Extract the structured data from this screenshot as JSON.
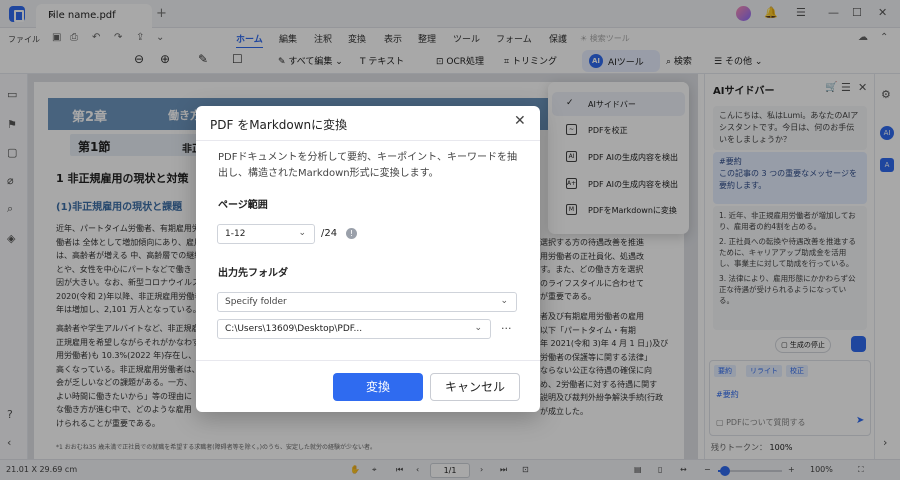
{
  "titlebar": {
    "tab_name": "File name.pdf",
    "close": "×",
    "plus": "+"
  },
  "menubar": {
    "file": "ファイル",
    "items": [
      "ホーム",
      "編集",
      "注釈",
      "変換",
      "表示",
      "整理",
      "ツール",
      "フォーム",
      "保護"
    ],
    "ocr_search": "検索ツール"
  },
  "toolbar": {
    "edit_all": "すべて編集",
    "text": "テキスト",
    "ocr": "OCR処理",
    "trim": "トリミング",
    "ai_tool": "AIツール",
    "search": "検索",
    "more": "その他"
  },
  "ai_menu": {
    "items": [
      "AIサイドバー",
      "PDFを校正",
      "PDF AIの生成内容を検出",
      "PDF AIの生成内容を検出",
      "PDFをMarkdownに変換"
    ]
  },
  "document": {
    "chapter": "第2章",
    "chapter_title": "働き方",
    "section": "第1節",
    "section_title": "非正規",
    "h1": "1 非正規雇用の現状と対策",
    "h2": "(1)非正規雇用の現状と課題",
    "para_left": [
      "近年、パートタイム労働者、有期雇用労",
      "働者は 全体として増加傾向にあり、雇用",
      "は、高齢者が増える 中、高齢層での継続",
      "とや、女性を中心にパートなどで働き",
      "因が大きい。なお、新型コロナウイルス",
      "2020(令和 2)年以降、非正規雇用労働者",
      "年は増加し、2,101 万人となっている。"
    ],
    "para_left2": [
      "高齢者や学生アルバイトなど、非正規雇",
      "正規雇用を希望しながらそれがかなわず",
      "用労働者)も 10.3%(2022 年)存在し、特",
      "高くなっている。非正規雇用労働者は、",
      "会が乏しいなどの課題がある。一方、",
      "よい時間に働きたいから」等の理由に",
      "な働き方が進む中で、どのような雇用",
      "けられることが重要である。"
    ],
    "para_right": [
      "選択する方の待遇改善を推進",
      "用労働者の正社員化、処遇改",
      "す。また、どの働き方を選択",
      "のライフスタイルに合わせて",
      "が重要である。"
    ],
    "para_right2": [
      "者及び有期雇用労働者の雇用",
      "以下「パートタイム・有期",
      "年 2021(令和 3)年 4 月 1 日」)及び",
      "労働者の保護等に関する法律」",
      "ならない公正な待遇の確保に向",
      "め、2労働者に対する待遇に関す",
      "説明及び裁判外紛争解決手続(行政",
      "が成立した。"
    ],
    "footnote": "*1 おおむね35 歳未満で正社員での就職を希望する求職者(障碍者等を除く。)のうち、安定した就労の経験が少ない者。"
  },
  "ai_sidebar": {
    "title": "AIサイドバー",
    "greeting": "こんにちは、私はLumi。あなたのAIアシスタントです。今日は、何のお手伝いをしましょうか？",
    "user_tag": "#要約",
    "user_msg": "この記事の 3 つの重要なメッセージを要約します。",
    "answer": [
      "1. 近年、非正規雇用労働者が増加しており、雇用者の約4割を占める。",
      "2. 正社員への転換や待遇改善を推進するために、キャリアアップ助成金を活用し、事業主に対して助成を行っている。",
      "3. 法律により、雇用形態にかかわらず公正な待遇が受けられるようになっている。"
    ],
    "stop": "生成の停止",
    "tabs": [
      "要約",
      "リライト",
      "校正"
    ],
    "input_tag": "#要約",
    "input_placeholder": "PDFについて質問する",
    "tokens_label": "残りトークン：",
    "tokens_value": "100%"
  },
  "status": {
    "size": "21.01 X 29.69 cm",
    "page": "1/1",
    "zoom": "100%"
  },
  "dialog": {
    "title": "PDF をMarkdownに変換",
    "description": "PDFドキュメントを分析して要約、キーポイント、キーワードを抽出し、構造されたMarkdown形式に変換します。",
    "page_range_label": "ページ範囲",
    "page_range_value": "1-12",
    "page_total": "/24",
    "output_label": "出力先フォルダ",
    "folder_select": "Specify folder",
    "folder_path": "C:\\Users\\13609\\Desktop\\PDF...",
    "convert": "変換",
    "cancel": "キャンセル"
  }
}
